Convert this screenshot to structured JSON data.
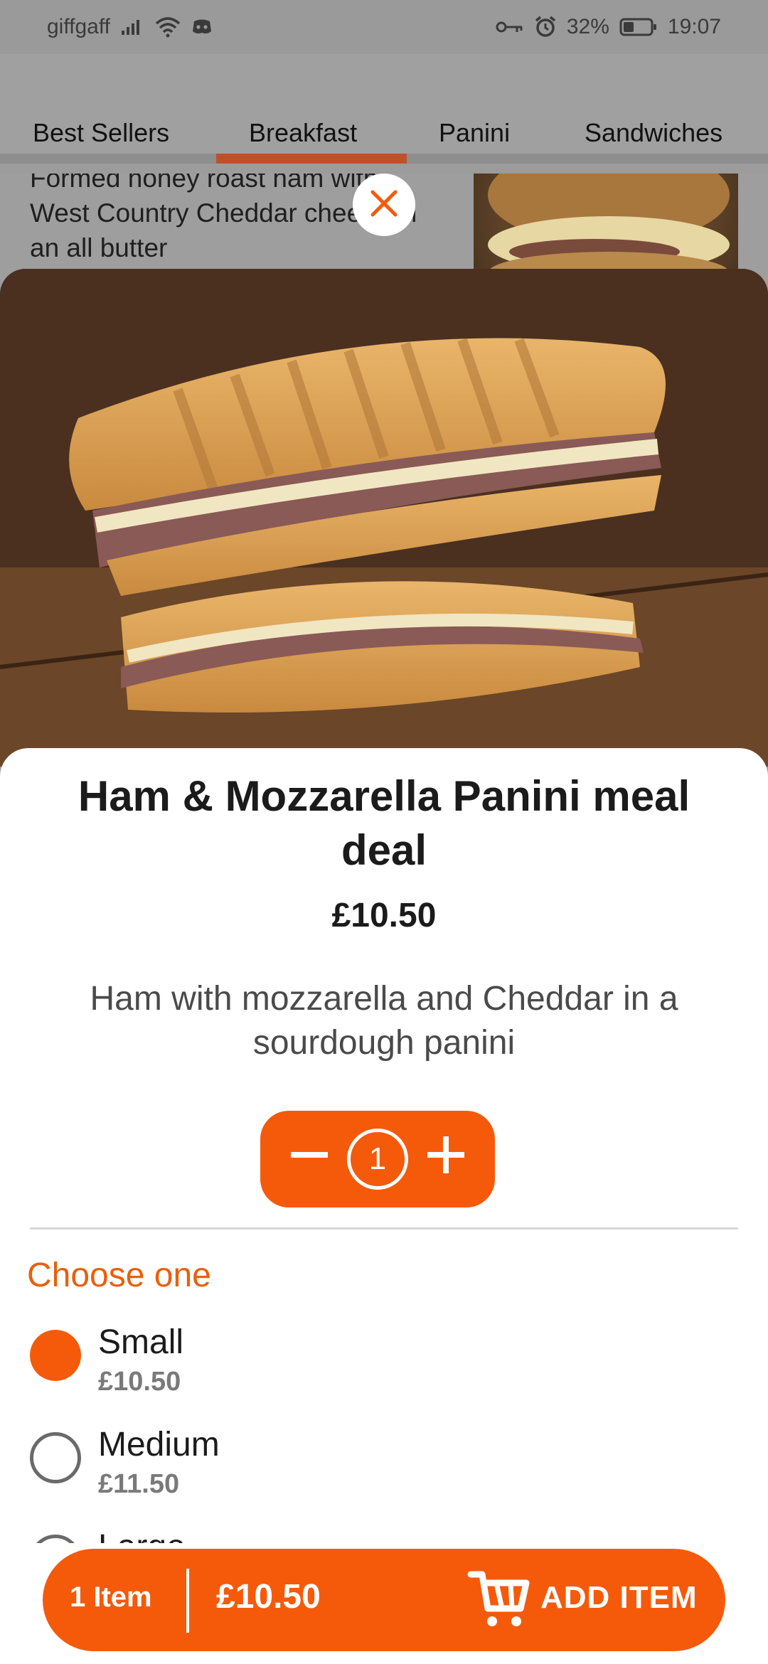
{
  "status_bar": {
    "carrier": "giffgaff",
    "battery": "32%",
    "time": "19:07"
  },
  "tabs": [
    {
      "label": "Best Sellers"
    },
    {
      "label": "Breakfast"
    },
    {
      "label": "Panini"
    },
    {
      "label": "Sandwiches"
    }
  ],
  "background_item": {
    "description": "Formed honey roast ham with West Country Cheddar cheese in an all butter"
  },
  "product": {
    "title": "Ham & Mozzarella Panini meal deal",
    "price": "£10.50",
    "description": "Ham with mozzarella and Cheddar in a sourdough panini",
    "quantity": "1"
  },
  "options": {
    "heading": "Choose one",
    "items": [
      {
        "label": "Small",
        "price": "£10.50",
        "selected": true
      },
      {
        "label": "Medium",
        "price": "£11.50",
        "selected": false
      },
      {
        "label": "Large",
        "price": "",
        "selected": false
      }
    ]
  },
  "cart_bar": {
    "items": "1 Item",
    "total": "£10.50",
    "action": "ADD ITEM"
  },
  "colors": {
    "accent": "#f55a0b",
    "heading_accent": "#e8600e",
    "tab_indicator": "#c0502a"
  },
  "icons": [
    "signal-icon",
    "wifi-icon",
    "discord-icon",
    "key-icon",
    "alarm-icon",
    "battery-icon",
    "close-icon",
    "minus-icon",
    "plus-icon",
    "cart-icon"
  ]
}
